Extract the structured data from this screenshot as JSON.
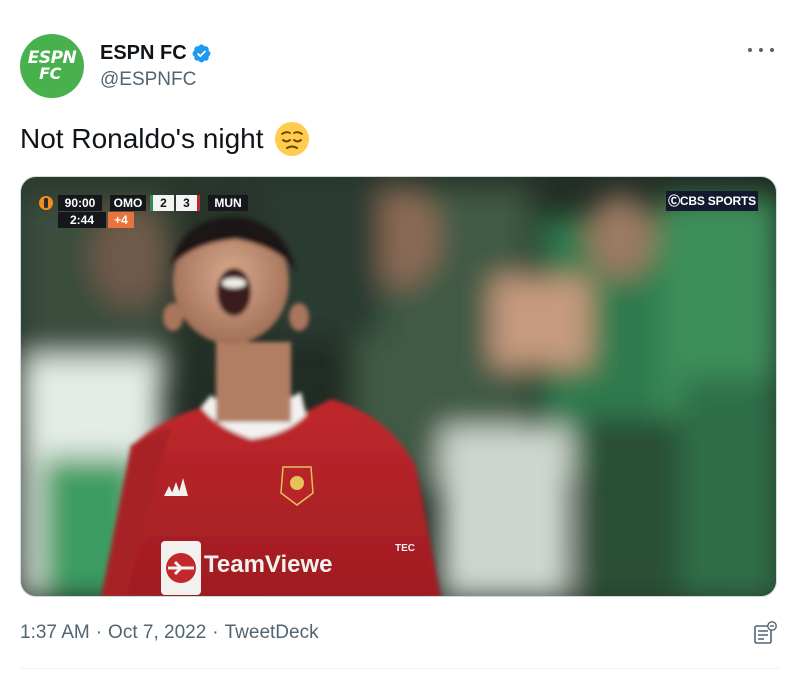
{
  "author": {
    "display_name": "ESPN FC",
    "handle": "@ESPNFC",
    "avatar_line1": "ESPN",
    "avatar_line2": "FC",
    "verified": true,
    "brand_color": "#49b04e",
    "verified_color": "#1d9bf0"
  },
  "tweet": {
    "text": "Not Ronaldo's night",
    "emoji": "pensive-face"
  },
  "media": {
    "scorebug": {
      "match_clock": "90:00",
      "home_team": "OMO",
      "home_score": "2",
      "away_score": "3",
      "away_team": "MUN",
      "stoppage_clock": "2:44",
      "added_time": "+4"
    },
    "broadcaster_logo": "ⒸCBS SPORTS",
    "kit_sponsor": "TeamViewe",
    "sleeve_text": "TEC"
  },
  "meta": {
    "time": "1:37 AM",
    "date": "Oct 7, 2022",
    "source": "TweetDeck",
    "separator": "·"
  }
}
